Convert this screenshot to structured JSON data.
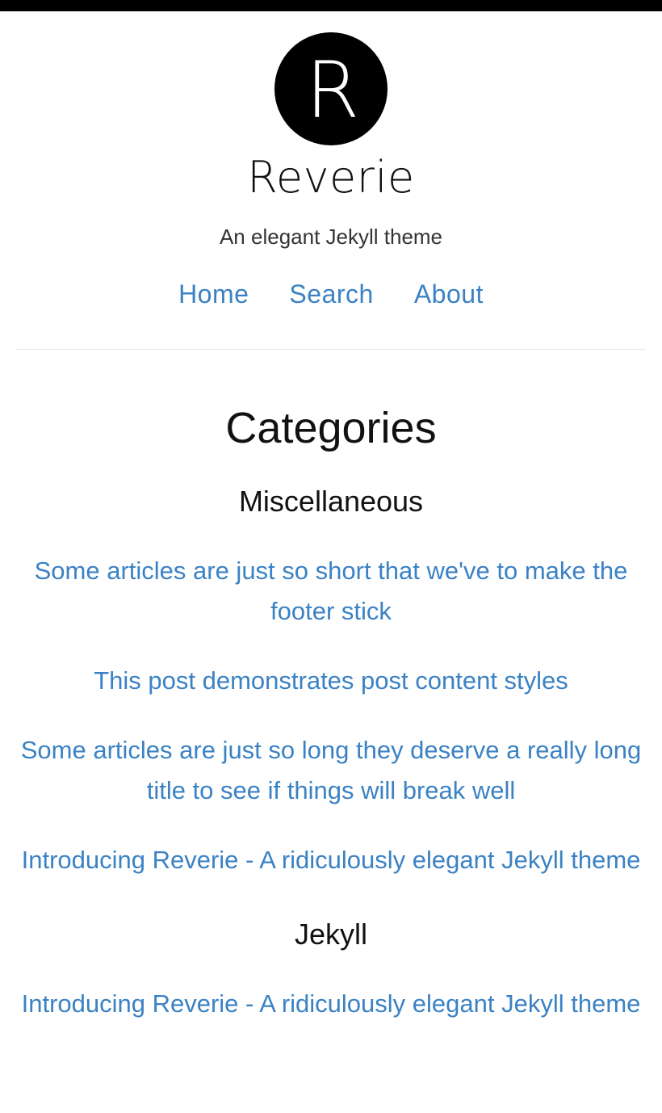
{
  "site": {
    "logo_letter": "R",
    "title": "Reverie",
    "tagline": "An elegant Jekyll theme"
  },
  "nav": {
    "items": [
      "Home",
      "Search",
      "About"
    ]
  },
  "page": {
    "title": "Categories"
  },
  "categories": [
    {
      "name": "Miscellaneous",
      "posts": [
        "Some articles are just so short that we've to make the footer stick",
        "This post demonstrates post content styles",
        "Some articles are just so long they deserve a really long title to see if things will break well",
        "Introducing Reverie - A ridiculously elegant Jekyll theme"
      ]
    },
    {
      "name": "Jekyll",
      "posts": [
        "Introducing Reverie - A ridiculously elegant Jekyll theme"
      ]
    }
  ],
  "colors": {
    "link": "#3b82c4",
    "text": "#111111",
    "top_bar": "#000000"
  }
}
